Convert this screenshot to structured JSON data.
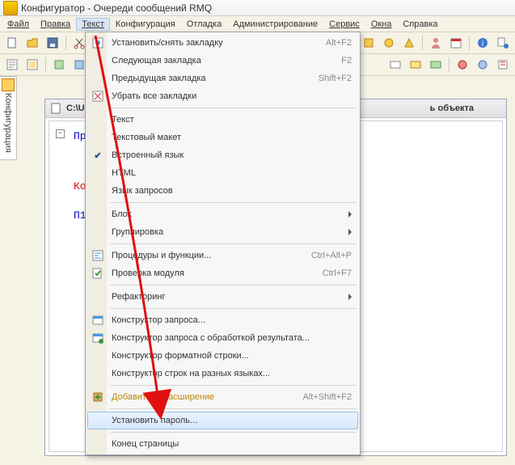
{
  "title": "Конфигуратор - Очереди сообщений RMQ",
  "menubar": [
    "Файл",
    "Правка",
    "Текст",
    "Конфигурация",
    "Отладка",
    "Администрирование",
    "Сервис",
    "Окна",
    "Справка"
  ],
  "side_tab": {
    "label": "Конфигурация"
  },
  "doc": {
    "path_prefix": "C:\\Us",
    "title_tail": "ь объекта",
    "code": {
      "l1": "Пр",
      "l2": "Ко",
      "l3": "П1"
    }
  },
  "dropdown": {
    "items": [
      {
        "icon": "bookmark-toggle-icon",
        "label": "Установить/снять закладку",
        "shortcut": "Alt+F2"
      },
      {
        "icon": "",
        "label": "Следующая закладка",
        "shortcut": "F2"
      },
      {
        "icon": "",
        "label": "Предыдущая закладка",
        "shortcut": "Shift+F2"
      },
      {
        "icon": "bookmark-clear-icon",
        "label": "Убрать все закладки",
        "shortcut": ""
      },
      {
        "sep": true
      },
      {
        "icon": "",
        "label": "Текст",
        "shortcut": ""
      },
      {
        "icon": "",
        "label": "Текстовый макет",
        "shortcut": ""
      },
      {
        "icon": "check",
        "label": "Встроенный язык",
        "shortcut": ""
      },
      {
        "icon": "",
        "label": "HTML",
        "shortcut": ""
      },
      {
        "icon": "",
        "label": "Язык запросов",
        "shortcut": ""
      },
      {
        "sep": true
      },
      {
        "icon": "",
        "label": "Блок",
        "submenu": true
      },
      {
        "icon": "",
        "label": "Группировка",
        "submenu": true
      },
      {
        "sep": true
      },
      {
        "icon": "proc-icon",
        "label": "Процедуры и функции...",
        "shortcut": "Ctrl+Alt+P"
      },
      {
        "icon": "check-module-icon",
        "label": "Проверка модуля",
        "shortcut": "Ctrl+F7"
      },
      {
        "sep": true
      },
      {
        "icon": "",
        "label": "Рефакторинг",
        "submenu": true
      },
      {
        "sep": true
      },
      {
        "icon": "query-builder-icon",
        "label": "Конструктор запроса..."
      },
      {
        "icon": "query-result-icon",
        "label": "Конструктор запроса с обработкой результата..."
      },
      {
        "icon": "",
        "label": "Конструктор форматной строки..."
      },
      {
        "icon": "",
        "label": "Конструктор строк на разных языках..."
      },
      {
        "sep": true
      },
      {
        "icon": "extension-add-icon",
        "label": "Добавить ... расширение",
        "shortcut": "Alt+Shift+F2"
      },
      {
        "sep": true
      },
      {
        "icon": "",
        "label": "Установить пароль...",
        "hl": true
      },
      {
        "sep": true
      },
      {
        "icon": "",
        "label": "Конец страницы"
      }
    ]
  }
}
